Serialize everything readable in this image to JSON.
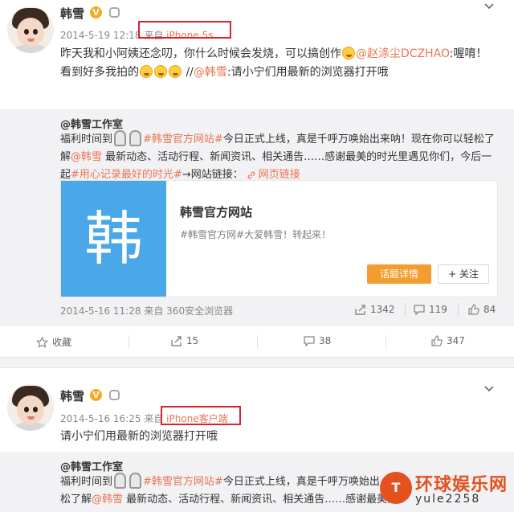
{
  "post1": {
    "author": "韩雪",
    "date": "2014-5-19 12:18",
    "source_prefix": "来自",
    "client": "iPhone 5s",
    "text_a": "昨天我和小阿姨还念叨，你什么时候会发烧，可以搞创作",
    "mention_a": "@赵涤尘DCZHAO",
    "text_b": ":喔唷！看到好多我拍的",
    "separator": "//",
    "mention_b": "@韩雪",
    "text_c": ":请小宁们用最新的浏览器打开哦",
    "repost": {
      "author": "@韩雪工作室",
      "line_pre": "福利时间到",
      "topic_a": "#韩雪官方网站#",
      "text_a": "今日正式上线，真是千呼万唤始出来呐！现在你可以轻松了解",
      "mention": "@韩雪",
      "text_b": " 最新动态、活动行程、新闻资讯、相关通告……感谢最美的时光里遇见你们，今后一起",
      "topic_b": "#用心记录最好的时光#",
      "text_c": "→网站链接：",
      "weblink": "网页链接",
      "card": {
        "thumb_char": "韩",
        "title": "韩雪官方网站",
        "desc": "#韩雪官方网#大爱韩雪！转起来！",
        "topic_button": "话题详情",
        "follow_button": "+ 关注"
      },
      "date": "2014-5-16 11:28",
      "source_prefix": "来自",
      "client": "360安全浏览器",
      "reposts": "1342",
      "comments": "119",
      "likes": "84"
    },
    "actions": {
      "favorite": "收藏",
      "repost": "15",
      "comment": "38",
      "like": "347"
    }
  },
  "post2": {
    "author": "韩雪",
    "date": "2014-5-16 16:25",
    "source_prefix": "来自",
    "client": "iPhone客户端",
    "text": "请小宁们用最新的浏览器打开哦",
    "repost": {
      "author": "@韩雪工作室",
      "line_pre": "福利时间到",
      "topic_a": "#韩雪官方网站#",
      "text_a": "今日正式上线，真是千呼万唤始出",
      "line2_pre": "松了解",
      "mention": "@韩雪",
      "text_b": " 最新动态、活动行程、新闻资讯、相关通告……感谢最美的"
    }
  },
  "watermark": {
    "logo": "T",
    "title": "环球娱乐网",
    "url": "yule2258"
  },
  "colors": {
    "link": "#eb7350",
    "highlight_box": "#d9232f",
    "topic_button": "#f39c2f",
    "card_thumb": "#4aa8e8"
  }
}
